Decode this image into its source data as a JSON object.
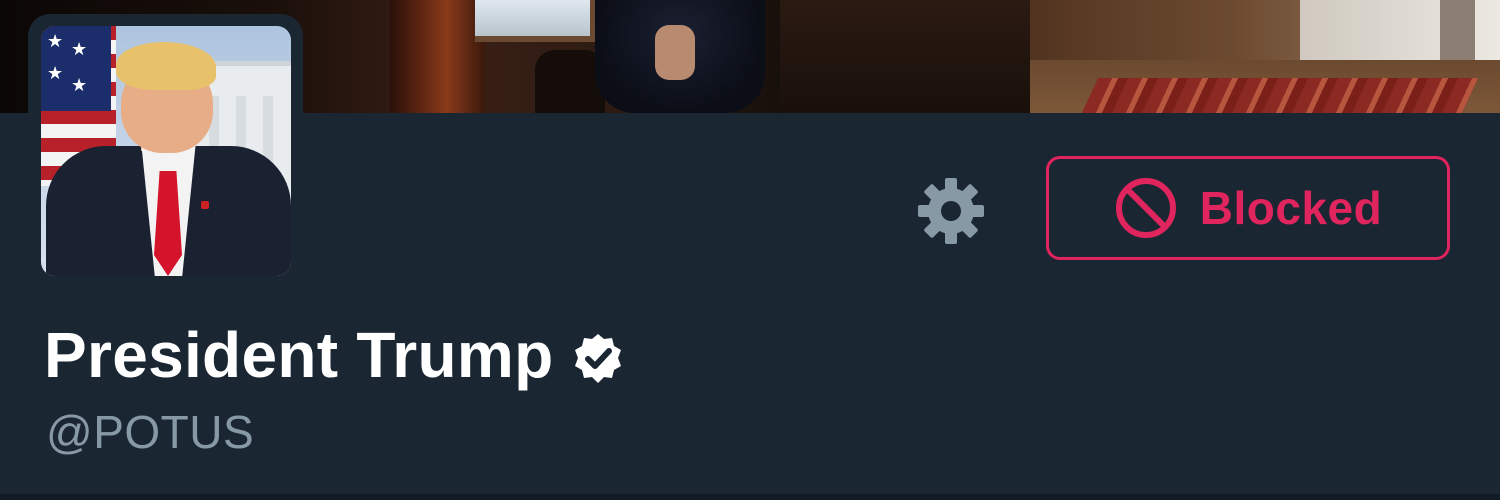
{
  "profile": {
    "display_name": "President Trump",
    "handle": "@POTUS",
    "verified": true
  },
  "actions": {
    "blocked_label": "Blocked",
    "settings_icon": "gear-icon",
    "blocked_icon": "no-entry-icon"
  },
  "colors": {
    "background": "#1b2633",
    "accent_red": "#e0245e",
    "handle_gray": "#8899a6",
    "gear_gray": "#8899a6",
    "name_white": "#ffffff"
  }
}
